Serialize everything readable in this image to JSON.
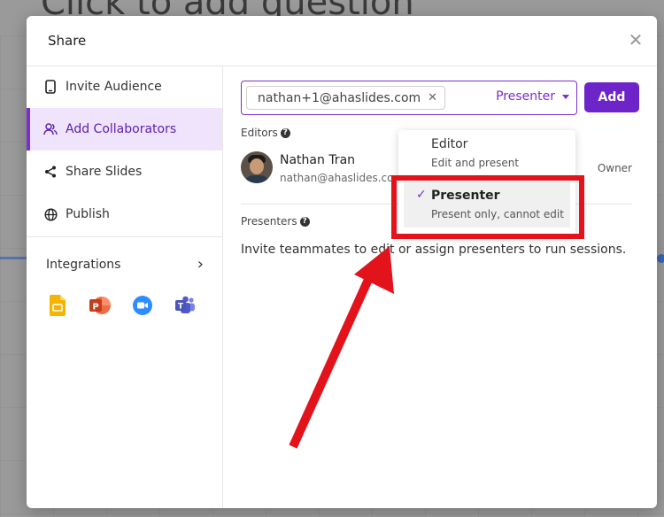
{
  "background": {
    "title": "Click to add question"
  },
  "modal": {
    "title": "Share",
    "close_icon": "close-icon",
    "sidebar": {
      "items": [
        {
          "label": "Invite Audience",
          "icon": "phone-icon"
        },
        {
          "label": "Add Collaborators",
          "icon": "users-icon",
          "active": true
        },
        {
          "label": "Share Slides",
          "icon": "share-icon"
        },
        {
          "label": "Publish",
          "icon": "globe-icon"
        }
      ],
      "integrations_label": "Integrations",
      "integration_icons": [
        "google-slides-icon",
        "powerpoint-icon",
        "zoom-icon",
        "teams-icon"
      ]
    },
    "invite": {
      "chip_email": "nathan+1@ahaslides.com",
      "role_value": "Presenter",
      "add_label": "Add"
    },
    "editors": {
      "label": "Editors",
      "user_name": "Nathan Tran",
      "user_email": "nathan@ahaslides.com",
      "owner_label": "Owner"
    },
    "presenters": {
      "label": "Presenters",
      "description": "Invite teammates to edit or assign presenters to run sessions."
    },
    "role_dropdown": {
      "options": [
        {
          "title": "Editor",
          "sub": "Edit and present"
        },
        {
          "title": "Presenter",
          "sub": "Present only, cannot edit",
          "selected": true
        }
      ]
    }
  },
  "colors": {
    "accent": "#7a2fd0",
    "annotation": "#e3131b"
  }
}
